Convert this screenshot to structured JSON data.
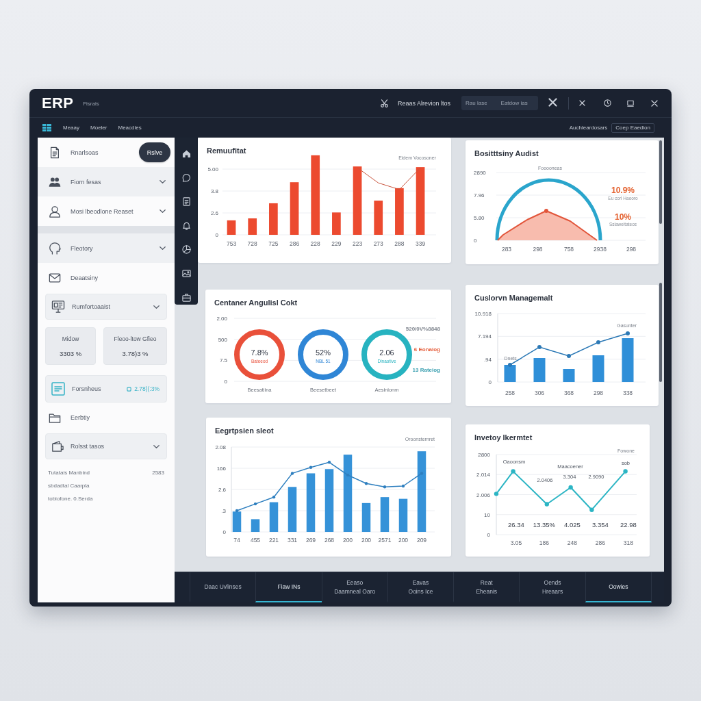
{
  "window": {
    "logo": "ERP",
    "subtitle": "Fisrais",
    "action": "Reaas Alrevion ltos",
    "filters": [
      "Rau lase",
      "Eatdow ias"
    ]
  },
  "menu": {
    "items": [
      "Meaay",
      "Moeler",
      "Meacdles"
    ],
    "status": "Auchleardosars",
    "button": "Coep Eaedion"
  },
  "sidebar": {
    "sections": [
      {
        "items": [
          {
            "kind": "row",
            "label": "Rnarlsoas",
            "highlighted": false,
            "button": "Rslve"
          },
          {
            "kind": "dropdown",
            "label": "Fiorn fesas",
            "highlighted": true
          },
          {
            "kind": "dropdown",
            "label": "Mosi lbeodlone Reaset",
            "highlighted": false
          }
        ]
      },
      {
        "items": [
          {
            "kind": "dropdown",
            "label": "Fleotory",
            "highlighted": true
          },
          {
            "kind": "row",
            "label": "Deaatsiny",
            "highlighted": false
          },
          {
            "kind": "card-dropdown",
            "label": "Rumfortoaaist"
          },
          {
            "kind": "tiles",
            "tiles": [
              {
                "label": "Midow",
                "value": "3303 %"
              },
              {
                "label": "Fleoo-ltow Gfieo",
                "value": "3.78)3 %"
              }
            ]
          },
          {
            "kind": "card-stat",
            "label": "Forsnheus",
            "value": "2.78)(:3%"
          },
          {
            "kind": "row",
            "label": "Eerbtiy",
            "highlighted": false
          },
          {
            "kind": "card-dropdown",
            "label": "Rolsst tasos"
          }
        ]
      }
    ],
    "footer": [
      {
        "label": "Tutatais Manbind",
        "value": "2583"
      },
      {
        "label": "sbdadtal Caarpla"
      },
      {
        "label": "tobiofone. 0.Serda"
      }
    ]
  },
  "cards": [
    {
      "kind": "bars",
      "scrollbar": false,
      "title": "Remuufitat",
      "legend": "Eidem Vocosoner",
      "y_labels": [
        "5.00",
        "3.8",
        "2.6",
        "0"
      ],
      "x_labels": [
        "753",
        "728",
        "725",
        "286",
        "228",
        "229",
        "223",
        "273",
        "288",
        "339"
      ]
    },
    {
      "kind": "gauge",
      "scrollbar": true,
      "title": "Bositttsiny Audist",
      "axis_labels": [
        "2890",
        "7.96",
        "5.80",
        "0"
      ],
      "caption": "Fooooneas",
      "x_labels": [
        "283",
        "298",
        "758",
        "2938",
        "298"
      ],
      "stats": [
        {
          "value": "10.9%",
          "label": "Eu corl Haooro"
        },
        {
          "value": "10%",
          "label": "Sslaweitateos"
        }
      ]
    },
    {
      "kind": "rings",
      "scrollbar": false,
      "title": "Centaner Angulisl Cokt",
      "axis_labels": [
        "2.00",
        "500",
        "7.5",
        "0"
      ],
      "rings": [
        {
          "value": "7.8%",
          "label": "Bateeod",
          "caption": "Beesatiina",
          "color": "#e9503a"
        },
        {
          "value": "52%",
          "label": "NBL 51",
          "caption": "Beesetbeet",
          "color": "#2f86d6"
        },
        {
          "value": "2.06",
          "label": "Dinaotive",
          "caption": "Aesinionm",
          "color": "#27b3c0"
        }
      ],
      "legend": [
        {
          "label": "520/0V%8848",
          "color": "#80868f"
        },
        {
          "label": "6 Eonaiog",
          "color": "#e6613f"
        },
        {
          "label": "13 Rateiog",
          "color": "#3a9fb0"
        }
      ]
    },
    {
      "kind": "bars",
      "scrollbar": true,
      "title": "Cuslorvn Managemalt",
      "series_labels": [
        "Dnets",
        "Gasunter"
      ],
      "y_labels": [
        "10.918",
        "7.194",
        ".94",
        "0"
      ],
      "x_labels": [
        "258",
        "306",
        "368",
        "298",
        "338"
      ]
    },
    {
      "kind": "bars",
      "scrollbar": false,
      "title": "Eegrtpsien sleot",
      "legend": "Oroonsternret",
      "y_labels": [
        "2.08",
        "166",
        "2.6",
        ".3",
        "0"
      ],
      "x_labels": [
        "74",
        "455",
        "221",
        "331",
        "269",
        "268",
        "200",
        "200",
        "2571",
        "200",
        "209"
      ]
    },
    {
      "kind": "line",
      "scrollbar": false,
      "title": "Invetoy Ikermtet",
      "legend": "Fowone",
      "annotations": [
        "Oaoonsm",
        "sob",
        "Maacoener",
        "3.304",
        "2.9090",
        "2.0406"
      ],
      "y_labels": [
        "2800",
        "2.014",
        "2.006",
        "10",
        "0"
      ],
      "value_labels": [
        "26.34",
        "13.35%",
        "4.025",
        "3.354",
        "22.98"
      ],
      "x_labels": [
        "3.05",
        "186",
        "248",
        "286",
        "318"
      ]
    }
  ],
  "tabs": [
    {
      "lines": [
        "Daac Uvlinses"
      ],
      "selected": false
    },
    {
      "lines": [
        "Fiaw INs"
      ],
      "selected": true
    },
    {
      "lines": [
        "Eeaso",
        "Daamneal Oaro"
      ],
      "selected": false
    },
    {
      "lines": [
        "Eavas",
        "Ooins Ice"
      ],
      "selected": false
    },
    {
      "lines": [
        "Reat",
        "Eheanis"
      ],
      "selected": false
    },
    {
      "lines": [
        "Oends",
        "Hreaars"
      ],
      "selected": false
    },
    {
      "lines": [
        "Oowies"
      ],
      "selected": true
    }
  ]
}
